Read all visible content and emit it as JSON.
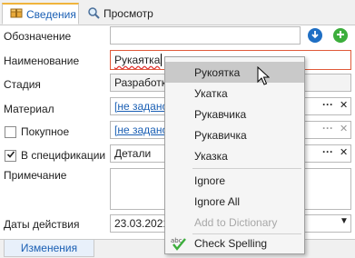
{
  "tabs": [
    {
      "label": "Сведения",
      "icon": "box-icon"
    },
    {
      "label": "Просмотр",
      "icon": "magnifier-icon"
    }
  ],
  "form": {
    "designation_label": "Обозначение",
    "designation_value": "",
    "name_label": "Наименование",
    "name_value": "Рукаятка",
    "stage_label": "Стадия",
    "stage_value": "Разработк",
    "material_label": "Материал",
    "material_value": "[не задано]",
    "purchased_label": "Покупное",
    "purchased_value": "[не задано]",
    "in_spec_label": "В спецификации",
    "in_spec_checked": true,
    "in_spec_value": "Детали",
    "note_label": "Примечание",
    "note_value": "",
    "dates_label": "Даты действия",
    "dates_value": "23.03.2021",
    "ellipsis": "···",
    "clear": "✕"
  },
  "context_menu": {
    "suggestions": [
      "Рукоятка",
      "Укатка",
      "Рукавчика",
      "Рукавичка",
      "Указка"
    ],
    "ignore": "Ignore",
    "ignore_all": "Ignore All",
    "add_to_dictionary": "Add to Dictionary",
    "check_spelling": "Check Spelling"
  },
  "bottom_tab": {
    "label": "Изменения"
  },
  "colors": {
    "accent_blue": "#1a5fb4",
    "error_red": "#e05a3a",
    "green": "#3cae3c",
    "orange_tab": "#f0b43c"
  }
}
